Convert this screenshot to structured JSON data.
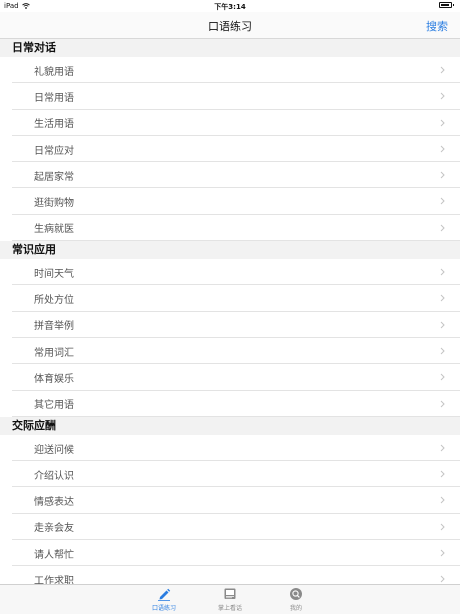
{
  "status_bar": {
    "device": "iPad",
    "time": "下午3:14",
    "battery_level": 0.85
  },
  "nav": {
    "title": "口语练习",
    "search_label": "搜索"
  },
  "sections": [
    {
      "header": "日常对话",
      "items": [
        "礼貌用语",
        "日常用语",
        "生活用语",
        "日常应对",
        "起居家常",
        "逛街购物",
        "生病就医"
      ]
    },
    {
      "header": "常识应用",
      "items": [
        "时间天气",
        "所处方位",
        "拼音举例",
        "常用词汇",
        "体育娱乐",
        "其它用语"
      ]
    },
    {
      "header": "交际应酬",
      "items": [
        "迎送问候",
        "介绍认识",
        "情感表达",
        "走亲会友",
        "请人帮忙",
        "工作求职"
      ]
    }
  ],
  "tabs": [
    {
      "label": "口语练习",
      "icon": "pencil-icon",
      "active": true
    },
    {
      "label": "掌上看话",
      "icon": "book-icon",
      "active": false
    },
    {
      "label": "我的",
      "icon": "profile-icon",
      "active": false
    }
  ],
  "colors": {
    "accent": "#2a7de1",
    "section_bg": "#f2f2f2",
    "inactive_tab": "#8a8a8a"
  }
}
